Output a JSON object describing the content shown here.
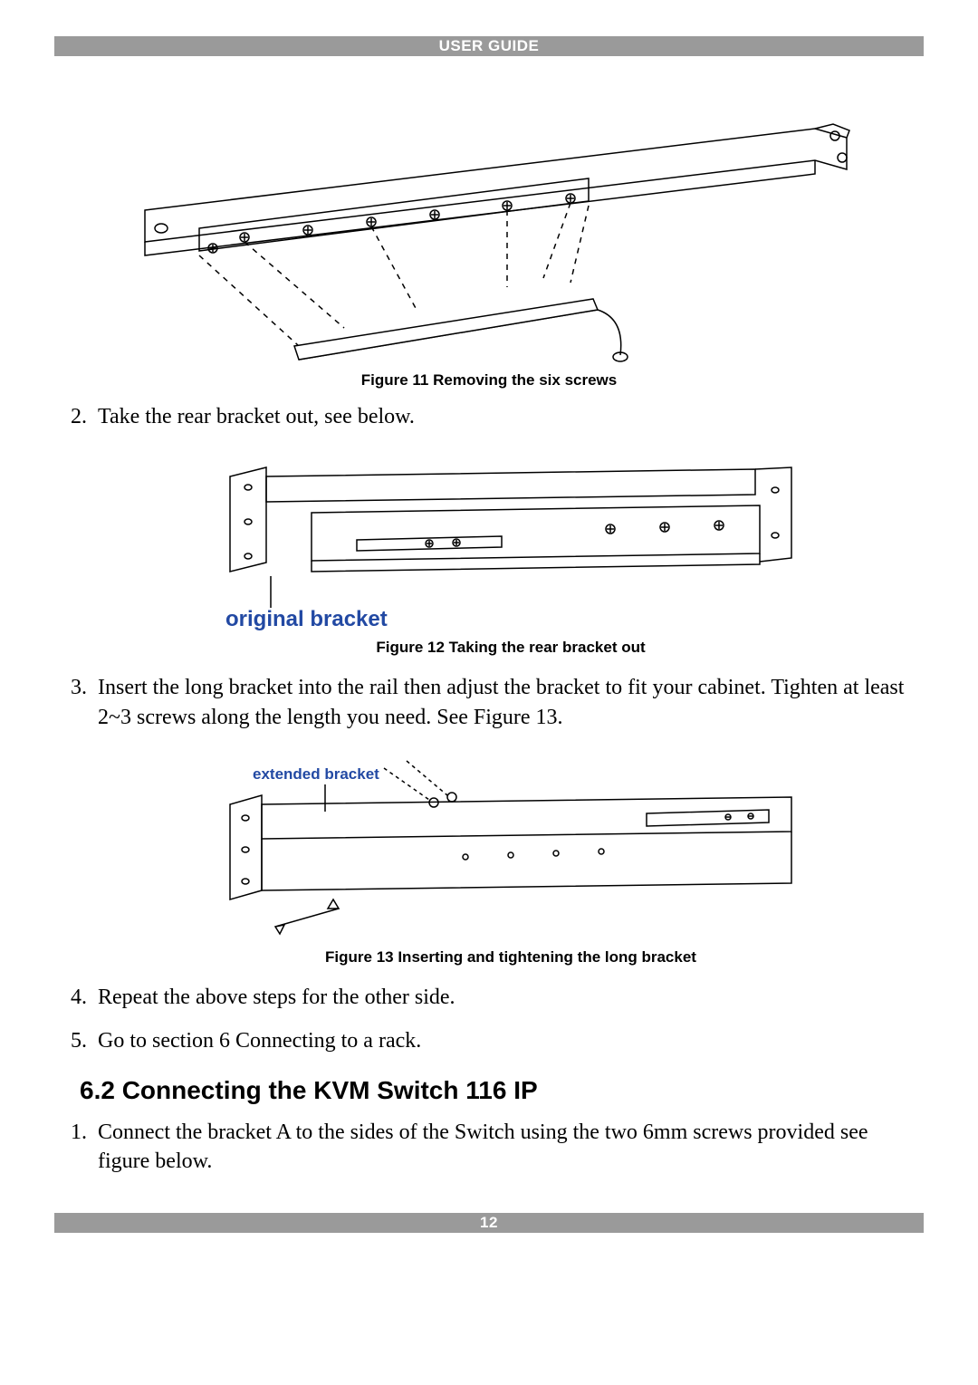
{
  "header": {
    "label": "USER GUIDE"
  },
  "footer": {
    "page_number": "12"
  },
  "figures": {
    "fig11": {
      "caption": "Figure 11 Removing the six screws"
    },
    "fig12": {
      "caption": "Figure 12 Taking the rear bracket out",
      "annotation": "original bracket"
    },
    "fig13": {
      "caption": "Figure 13 Inserting and tightening the long bracket",
      "annotation": "extended bracket"
    }
  },
  "list_a": {
    "item2": "Take the rear bracket out, see below.",
    "item3": "Insert the long bracket into the rail then adjust the bracket to fit your cabinet. Tighten at least 2~3 screws along the length you need. See Figure 13.",
    "item4": "Repeat the above steps for the other side.",
    "item5": "Go to section 6 Connecting to a rack."
  },
  "section": {
    "heading": "6.2 Connecting the KVM Switch 116 IP"
  },
  "list_b": {
    "item1": "Connect the bracket A to the sides of the Switch using the two 6mm screws provided see figure below."
  }
}
